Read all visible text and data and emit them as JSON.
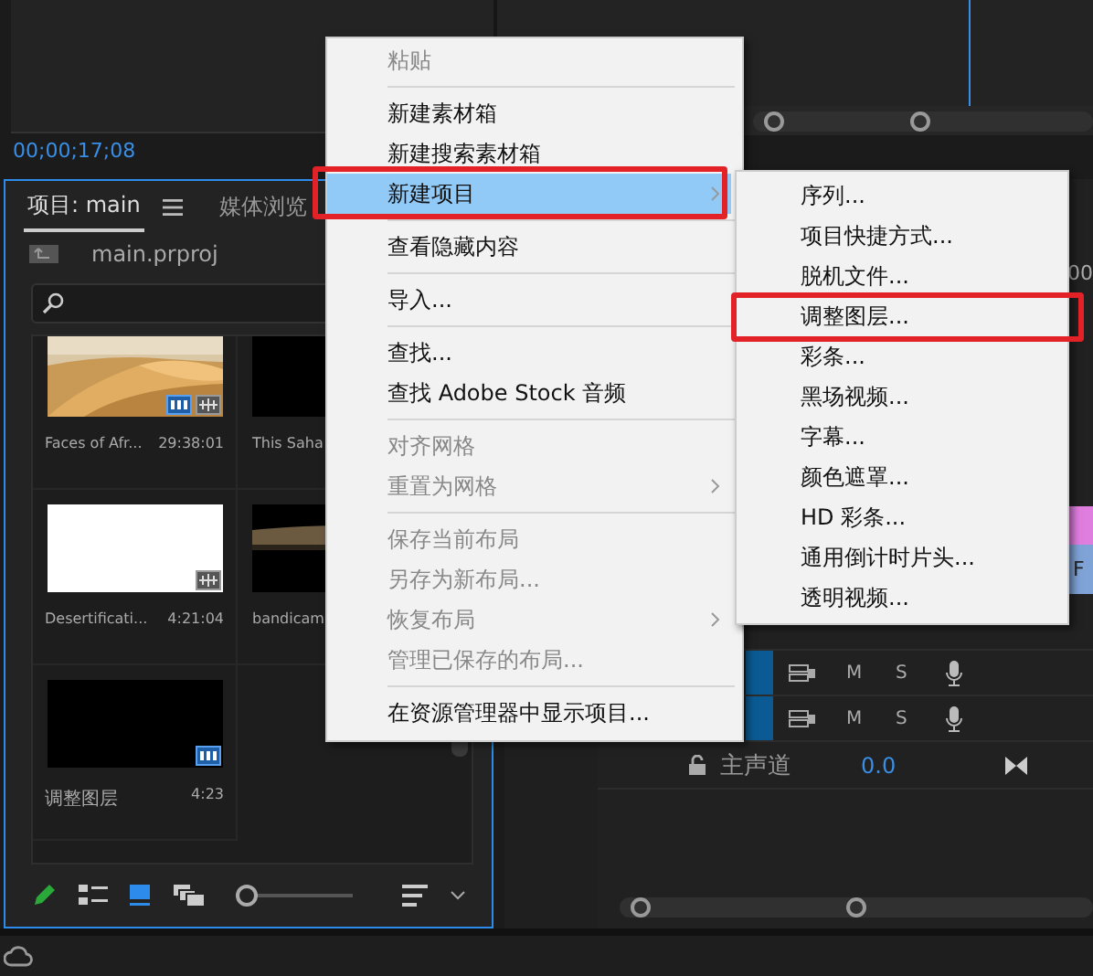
{
  "source_monitor": {
    "timecode": "00;00;17;08"
  },
  "project_panel": {
    "tabs": [
      {
        "label": "项目: main",
        "selected": true
      },
      {
        "label": "媒体浏览",
        "selected": false
      }
    ],
    "path": "main.prproj",
    "items": [
      {
        "name": "Faces of Afr...",
        "duration": "29:38:01",
        "kind": "desert",
        "video": true,
        "audio": true
      },
      {
        "name": "This Saha",
        "kind": "black",
        "video": false,
        "audio": false
      },
      {
        "name": "Desertificati...",
        "duration": "4:21:04",
        "kind": "white",
        "video": false,
        "audio": true
      },
      {
        "name": "bandicam",
        "kind": "dim",
        "video": false,
        "audio": false
      },
      {
        "name": "调整图层",
        "duration": "4:23",
        "kind": "black",
        "video": true,
        "audio": false
      }
    ],
    "views": [
      {
        "kind": "list",
        "selected": false
      },
      {
        "kind": "icon",
        "selected": true
      },
      {
        "kind": "freeform",
        "selected": false
      }
    ],
    "zoom": {
      "level": 0
    }
  },
  "timeline": {
    "ruler_time": "00",
    "clips": [
      {
        "color": "#e07ee0"
      },
      {
        "color": "#7fa3d6",
        "label": "F"
      }
    ],
    "tracks": [
      {
        "mute": "M",
        "solo": "S"
      },
      {
        "mute": "M",
        "solo": "S"
      }
    ],
    "master": {
      "label": "主声道",
      "value": "0.0"
    }
  },
  "context_menu": {
    "items": [
      {
        "kind": "item",
        "label": "粘贴",
        "disabled": true,
        "selected": false,
        "submenu": false,
        "framed": false
      },
      {
        "kind": "separator"
      },
      {
        "kind": "item",
        "label": "新建素材箱",
        "disabled": false,
        "selected": false,
        "submenu": false,
        "framed": false
      },
      {
        "kind": "item",
        "label": "新建搜索素材箱",
        "disabled": false,
        "selected": false,
        "submenu": false,
        "framed": false
      },
      {
        "kind": "item",
        "label": "新建项目",
        "disabled": false,
        "selected": true,
        "submenu": true,
        "framed": true
      },
      {
        "kind": "separator"
      },
      {
        "kind": "item",
        "label": "查看隐藏内容",
        "disabled": false,
        "selected": false,
        "submenu": false,
        "framed": false
      },
      {
        "kind": "separator"
      },
      {
        "kind": "item",
        "label": "导入...",
        "disabled": false,
        "selected": false,
        "submenu": false,
        "framed": false
      },
      {
        "kind": "separator"
      },
      {
        "kind": "item",
        "label": "查找...",
        "disabled": false,
        "selected": false,
        "submenu": false,
        "framed": false
      },
      {
        "kind": "item",
        "label": "查找 Adobe Stock 音频",
        "disabled": false,
        "selected": false,
        "submenu": false,
        "framed": false
      },
      {
        "kind": "separator"
      },
      {
        "kind": "item",
        "label": "对齐网格",
        "disabled": true,
        "selected": false,
        "submenu": false,
        "framed": false
      },
      {
        "kind": "item",
        "label": "重置为网格",
        "disabled": true,
        "selected": false,
        "submenu": true,
        "framed": false
      },
      {
        "kind": "separator"
      },
      {
        "kind": "item",
        "label": "保存当前布局",
        "disabled": true,
        "selected": false,
        "submenu": false,
        "framed": false
      },
      {
        "kind": "item",
        "label": "另存为新布局...",
        "disabled": true,
        "selected": false,
        "submenu": false,
        "framed": false
      },
      {
        "kind": "item",
        "label": "恢复布局",
        "disabled": true,
        "selected": false,
        "submenu": true,
        "framed": false
      },
      {
        "kind": "item",
        "label": "管理已保存的布局...",
        "disabled": true,
        "selected": false,
        "submenu": false,
        "framed": false
      },
      {
        "kind": "separator"
      },
      {
        "kind": "item",
        "label": "在资源管理器中显示项目...",
        "disabled": false,
        "selected": false,
        "submenu": false,
        "framed": false
      }
    ]
  },
  "submenu": {
    "items": [
      {
        "label": "序列...",
        "framed": false
      },
      {
        "label": "项目快捷方式...",
        "framed": false
      },
      {
        "label": "脱机文件...",
        "framed": false
      },
      {
        "label": "调整图层...",
        "framed": true
      },
      {
        "label": "彩条...",
        "framed": false
      },
      {
        "label": "黑场视频...",
        "framed": false
      },
      {
        "label": "字幕...",
        "framed": false
      },
      {
        "label": "颜色遮罩...",
        "framed": false
      },
      {
        "label": "HD 彩条...",
        "framed": false
      },
      {
        "label": "通用倒计时片头...",
        "framed": false
      },
      {
        "label": "透明视频...",
        "framed": false
      }
    ]
  }
}
